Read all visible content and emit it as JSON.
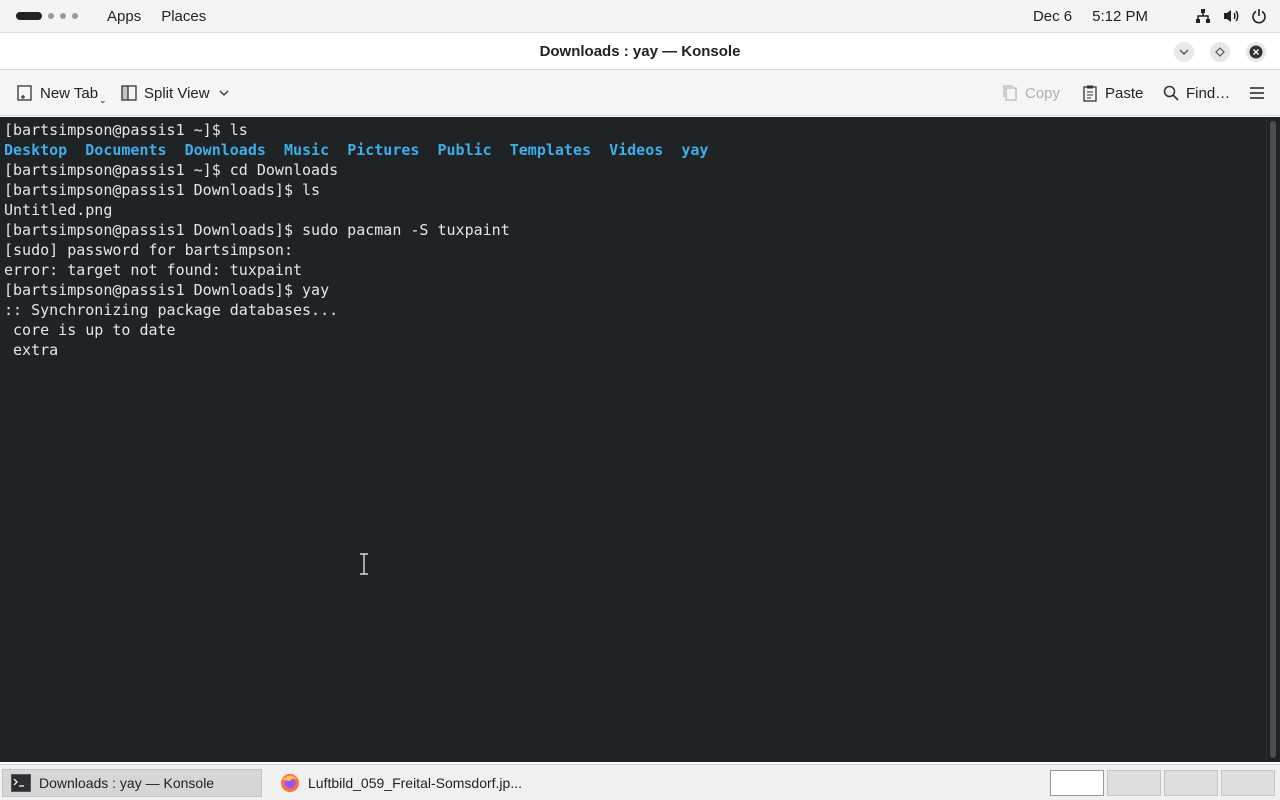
{
  "top_panel": {
    "apps_label": "Apps",
    "places_label": "Places",
    "date": "Dec 6",
    "time": "5:12 PM",
    "tray_icons": [
      "network-icon",
      "volume-icon",
      "power-icon"
    ]
  },
  "window": {
    "title": "Downloads : yay — Konsole",
    "buttons": [
      "minimize",
      "maximize",
      "close"
    ]
  },
  "toolbar": {
    "new_tab_label": "New Tab",
    "split_view_label": "Split View",
    "copy_label": "Copy",
    "paste_label": "Paste",
    "find_label": "Find…"
  },
  "terminal": {
    "lines": [
      {
        "text": "[bartsimpson@passis1 ~]$ ls"
      },
      {
        "dirs": [
          "Desktop",
          "Documents",
          "Downloads",
          "Music",
          "Pictures",
          "Public",
          "Templates",
          "Videos",
          "yay"
        ]
      },
      {
        "text": "[bartsimpson@passis1 ~]$ cd Downloads"
      },
      {
        "text": "[bartsimpson@passis1 Downloads]$ ls"
      },
      {
        "text": "Untitled.png"
      },
      {
        "text": "[bartsimpson@passis1 Downloads]$ sudo pacman -S tuxpaint"
      },
      {
        "text": "[sudo] password for bartsimpson:"
      },
      {
        "text": "error: target not found: tuxpaint"
      },
      {
        "text": "[bartsimpson@passis1 Downloads]$ yay"
      },
      {
        "text": ":: Synchronizing package databases..."
      },
      {
        "text": " core is up to date"
      },
      {
        "text": " extra"
      }
    ],
    "colors": {
      "background": "#1f2326",
      "foreground": "#e6e6e6",
      "directory": "#3daee9"
    }
  },
  "taskbar": {
    "tasks": [
      {
        "label": "Downloads : yay — Konsole",
        "icon": "terminal-icon",
        "active": true
      },
      {
        "label": "Luftbild_059_Freital-Somsdorf.jp...",
        "icon": "firefox-icon",
        "active": false
      }
    ],
    "workspaces": 4,
    "current_workspace": 1
  }
}
